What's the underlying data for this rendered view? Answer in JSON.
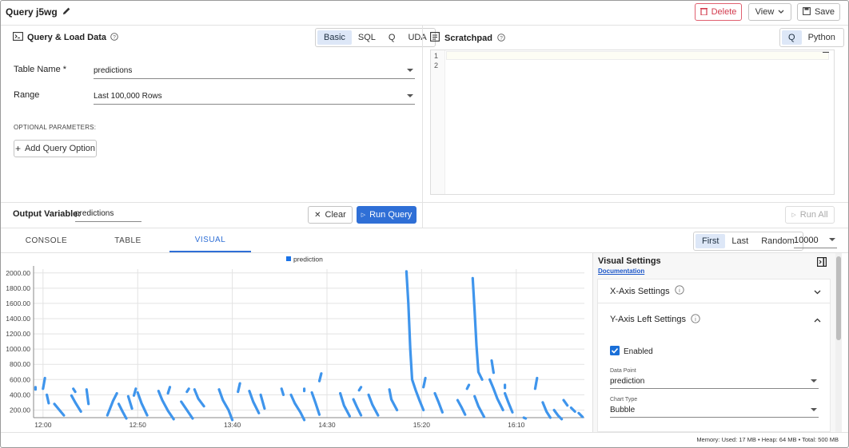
{
  "header": {
    "title": "Query j5wg",
    "edit_icon": "pencil-icon",
    "delete_label": "Delete",
    "view_label": "View",
    "save_label": "Save"
  },
  "query_panel": {
    "title": "Query & Load Data",
    "modes": [
      "Basic",
      "SQL",
      "Q",
      "UDA"
    ],
    "active_mode": "Basic",
    "table_name_label": "Table Name *",
    "table_name_value": "predictions",
    "range_label": "Range",
    "range_value": "Last 100,000 Rows",
    "optional_label": "OPTIONAL PARAMETERS:",
    "add_option_label": "Add Query Option",
    "output_label": "Output Variable:",
    "output_value": "predictions",
    "clear_label": "Clear",
    "run_label": "Run Query"
  },
  "scratchpad": {
    "title": "Scratchpad",
    "langs": [
      "Q",
      "Python"
    ],
    "active_lang": "Q",
    "line_numbers": [
      "1",
      "2"
    ],
    "run_all_label": "Run All"
  },
  "results": {
    "tabs": [
      "CONSOLE",
      "TABLE",
      "VISUAL"
    ],
    "active_tab": "VISUAL",
    "paging": [
      "First",
      "Last",
      "Random"
    ],
    "active_paging": "First",
    "rows_value": "10000"
  },
  "chart_data": {
    "type": "scatter",
    "legend": [
      "prediction"
    ],
    "legend_color": "#1a73e8",
    "series_color": "#3f95ec",
    "ylim": [
      100,
      2050
    ],
    "yticks": [
      "2000.00",
      "1800.00",
      "1600.00",
      "1400.00",
      "1200.00",
      "1000.00",
      "800.00",
      "600.00",
      "400.00",
      "200.00"
    ],
    "ytick_values": [
      2000,
      1800,
      1600,
      1400,
      1200,
      1000,
      800,
      600,
      400,
      200
    ],
    "xticks": [
      "12:00",
      "12:50",
      "13:40",
      "14:30",
      "15:20",
      "16:10"
    ],
    "xtick_minutes": [
      720,
      770,
      820,
      870,
      920,
      970
    ],
    "xlim": [
      715,
      1006
    ],
    "strokes": [
      [
        [
          716,
          470
        ],
        [
          716,
          500
        ]
      ],
      [
        [
          720,
          480
        ],
        [
          721,
          620
        ]
      ],
      [
        [
          722,
          400
        ],
        [
          723,
          290
        ]
      ],
      [
        [
          726,
          280
        ],
        [
          729,
          190
        ],
        [
          731,
          130
        ]
      ],
      [
        [
          735,
          390
        ],
        [
          737,
          300
        ],
        [
          740,
          180
        ]
      ],
      [
        [
          736,
          480
        ],
        [
          737,
          440
        ]
      ],
      [
        [
          743,
          470
        ],
        [
          744,
          280
        ]
      ],
      [
        [
          754,
          130
        ],
        [
          757,
          320
        ],
        [
          759,
          420
        ]
      ],
      [
        [
          760,
          280
        ],
        [
          762,
          180
        ],
        [
          764,
          90
        ]
      ],
      [
        [
          765,
          380
        ],
        [
          767,
          220
        ]
      ],
      [
        [
          768,
          390
        ],
        [
          769,
          480
        ]
      ],
      [
        [
          770,
          430
        ],
        [
          772,
          290
        ],
        [
          775,
          130
        ]
      ],
      [
        [
          781,
          450
        ],
        [
          783,
          330
        ],
        [
          786,
          190
        ],
        [
          789,
          80
        ]
      ],
      [
        [
          786,
          420
        ],
        [
          787,
          500
        ]
      ],
      [
        [
          793,
          310
        ],
        [
          796,
          200
        ],
        [
          799,
          90
        ]
      ],
      [
        [
          796,
          440
        ],
        [
          797,
          480
        ]
      ],
      [
        [
          800,
          470
        ],
        [
          802,
          350
        ],
        [
          805,
          250
        ]
      ],
      [
        [
          813,
          470
        ],
        [
          815,
          330
        ],
        [
          818,
          200
        ],
        [
          820,
          70
        ]
      ],
      [
        [
          823,
          440
        ],
        [
          824,
          550
        ]
      ],
      [
        [
          829,
          450
        ],
        [
          831,
          310
        ],
        [
          834,
          160
        ]
      ],
      [
        [
          835,
          400
        ],
        [
          837,
          220
        ]
      ],
      [
        [
          846,
          480
        ],
        [
          847,
          400
        ]
      ],
      [
        [
          851,
          400
        ],
        [
          853,
          290
        ],
        [
          856,
          170
        ],
        [
          858,
          70
        ]
      ],
      [
        [
          858,
          450
        ],
        [
          858,
          480
        ]
      ],
      [
        [
          862,
          430
        ],
        [
          864,
          290
        ],
        [
          866,
          140
        ]
      ],
      [
        [
          866,
          580
        ],
        [
          867,
          680
        ]
      ],
      [
        [
          877,
          420
        ],
        [
          879,
          260
        ],
        [
          882,
          120
        ]
      ],
      [
        [
          884,
          340
        ],
        [
          886,
          230
        ],
        [
          888,
          130
        ]
      ],
      [
        [
          887,
          460
        ],
        [
          888,
          500
        ]
      ],
      [
        [
          892,
          400
        ],
        [
          894,
          270
        ],
        [
          897,
          130
        ]
      ],
      [
        [
          903,
          470
        ],
        [
          904,
          340
        ],
        [
          907,
          200
        ]
      ],
      [
        [
          912,
          2020
        ],
        [
          913,
          1600
        ],
        [
          914,
          1000
        ],
        [
          915,
          600
        ],
        [
          917,
          450
        ],
        [
          919,
          320
        ],
        [
          921,
          200
        ]
      ],
      [
        [
          921,
          500
        ],
        [
          922,
          620
        ]
      ],
      [
        [
          927,
          420
        ],
        [
          929,
          300
        ],
        [
          931,
          170
        ]
      ],
      [
        [
          939,
          330
        ],
        [
          941,
          240
        ],
        [
          943,
          140
        ]
      ],
      [
        [
          944,
          480
        ],
        [
          945,
          530
        ]
      ],
      [
        [
          948,
          380
        ],
        [
          950,
          250
        ],
        [
          953,
          110
        ]
      ],
      [
        [
          947,
          1930
        ],
        [
          948,
          1500
        ],
        [
          949,
          1050
        ],
        [
          950,
          700
        ],
        [
          952,
          600
        ]
      ],
      [
        [
          956,
          600
        ],
        [
          958,
          480
        ],
        [
          960,
          350
        ],
        [
          963,
          200
        ]
      ],
      [
        [
          957,
          850
        ],
        [
          958,
          690
        ]
      ],
      [
        [
          964,
          420
        ],
        [
          966,
          290
        ],
        [
          968,
          170
        ]
      ],
      [
        [
          964,
          530
        ],
        [
          964,
          490
        ]
      ],
      [
        [
          974,
          100
        ],
        [
          975,
          90
        ]
      ],
      [
        [
          980,
          480
        ],
        [
          981,
          620
        ]
      ],
      [
        [
          984,
          300
        ],
        [
          986,
          180
        ],
        [
          988,
          100
        ]
      ],
      [
        [
          990,
          200
        ],
        [
          992,
          130
        ],
        [
          994,
          80
        ]
      ],
      [
        [
          995,
          330
        ],
        [
          997,
          260
        ]
      ],
      [
        [
          999,
          230
        ],
        [
          1001,
          180
        ]
      ],
      [
        [
          1003,
          160
        ],
        [
          1005,
          110
        ]
      ]
    ]
  },
  "visual_settings": {
    "title": "Visual Settings",
    "doc_link": "Documentation",
    "x_axis_label": "X-Axis Settings",
    "y_axis_label": "Y-Axis Left Settings",
    "enabled_label": "Enabled",
    "data_point_label": "Data Point",
    "data_point_value": "prediction",
    "chart_type_label": "Chart Type",
    "chart_type_value": "Bubble"
  },
  "status": {
    "text": "Memory:  Used: 17 MB • Heap: 64 MB • Total: 500 MB"
  }
}
